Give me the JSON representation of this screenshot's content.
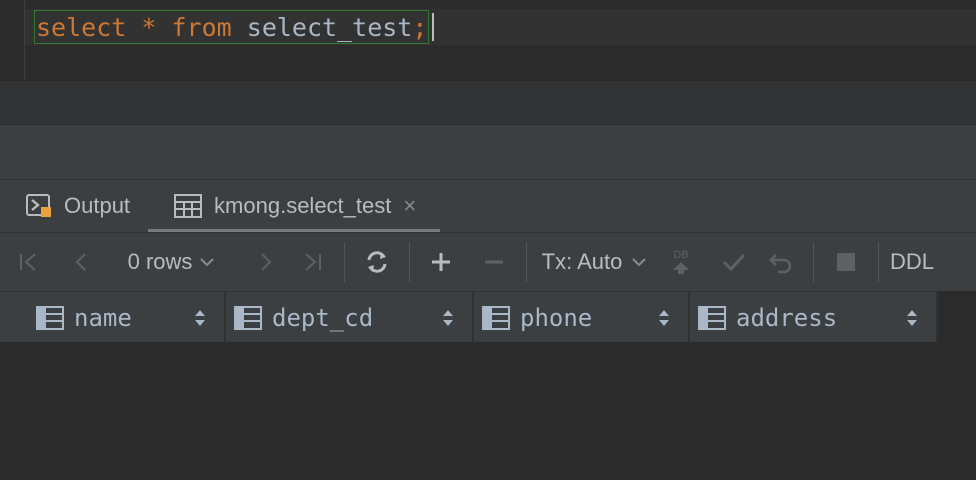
{
  "editor": {
    "code": {
      "kw_select": "select",
      "star": "*",
      "kw_from": "from",
      "table": "select_test",
      "semicolon": ";"
    }
  },
  "tabs": [
    {
      "label": "Output",
      "icon": "console-icon"
    },
    {
      "label": "kmong.select_test",
      "icon": "table-icon",
      "active": true,
      "close": "×"
    }
  ],
  "toolbar": {
    "rows_label": "0 rows",
    "tx_label": "Tx: Auto",
    "db_badge": "DB",
    "ddl_label": "DDL"
  },
  "columns": [
    {
      "name": "name"
    },
    {
      "name": "dept_cd"
    },
    {
      "name": "phone"
    },
    {
      "name": "address"
    }
  ],
  "colors": {
    "keyword": "#cc7832",
    "identifier": "#a9b7c6",
    "statement_border": "#2f7a2f",
    "panel_bg": "#3c3f41",
    "editor_bg": "#2b2b2b"
  }
}
